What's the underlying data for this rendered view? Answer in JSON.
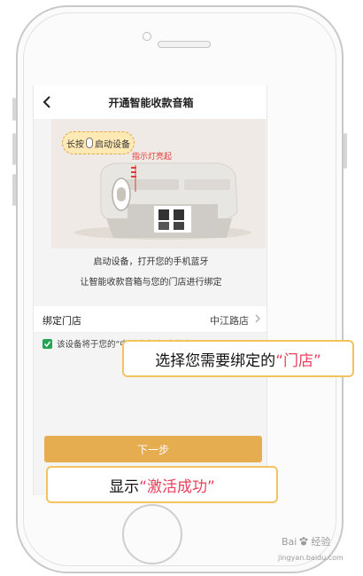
{
  "nav": {
    "title": "开通智能收款音箱",
    "back_icon": "chevron-left-icon"
  },
  "illustration": {
    "bubble_prefix": "长按",
    "bubble_suffix": "启动设备",
    "led_label": "指示灯亮起"
  },
  "info": {
    "line1": "启动设备，打开您的手机蓝牙",
    "line2": "让智能收款音箱与您的门店进行绑定"
  },
  "bind_store": {
    "label": "绑定门店",
    "value": "中江路店"
  },
  "agreement": {
    "text": "该设备将于您的“中江路店”门店绑定"
  },
  "next_button": {
    "label": "下一步"
  },
  "callouts": {
    "top": {
      "prefix": "选择您需要绑定的",
      "highlight": "“门店”"
    },
    "bottom": {
      "prefix": "显示",
      "highlight": "“激活成功”"
    }
  },
  "watermark": {
    "left": "Bai",
    "right": "经验",
    "url": "jingyan.baidu.com"
  },
  "colors": {
    "accent": "#e6ac50",
    "highlight": "#e83f5b",
    "checkbox": "#23a455",
    "callout_border": "#f2c35f"
  }
}
